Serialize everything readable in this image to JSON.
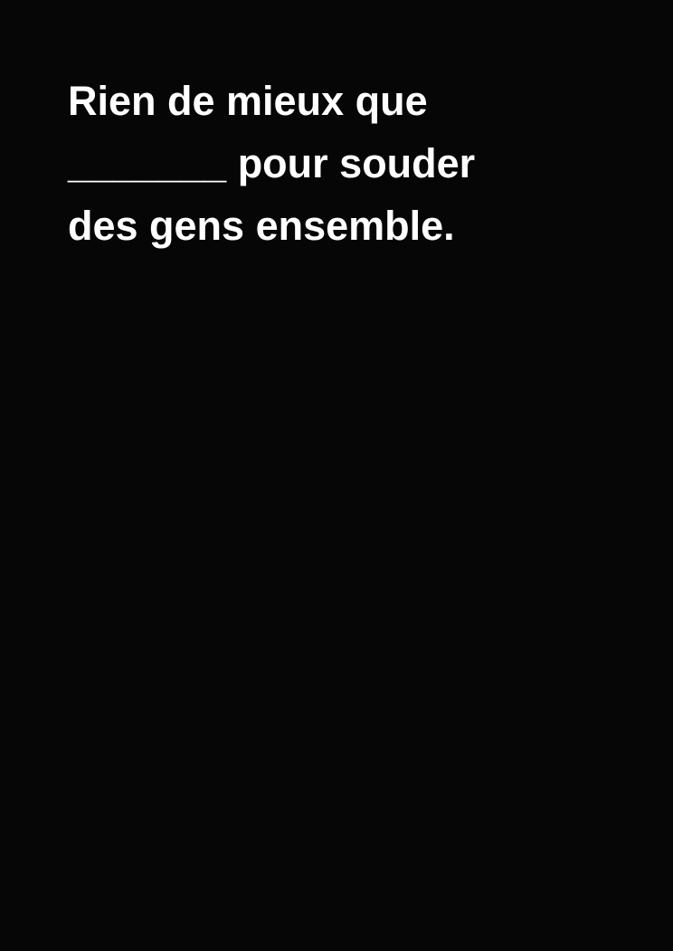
{
  "card": {
    "color": "black",
    "background_color": "#060606",
    "text_color": "#ffffff",
    "lines": [
      "Rien de mieux que",
      "_______ pour souder",
      "des gens ensemble."
    ]
  }
}
